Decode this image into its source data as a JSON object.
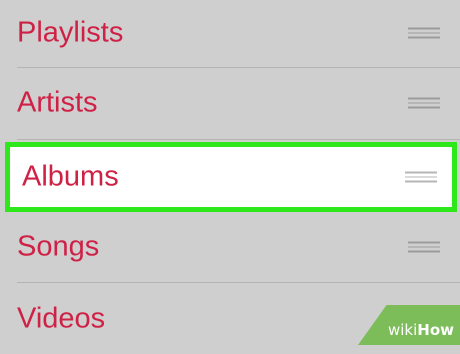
{
  "menu": {
    "items": [
      {
        "label": "Playlists"
      },
      {
        "label": "Artists"
      },
      {
        "label": "Albums",
        "selected": true
      },
      {
        "label": "Songs"
      },
      {
        "label": "Videos"
      }
    ]
  },
  "colors": {
    "label": "#cf2146",
    "highlight_border": "#2ee81b",
    "background": "#cfcfcf",
    "selected_background": "#ffffff"
  },
  "watermark": {
    "prefix": "wiki",
    "suffix": "How"
  }
}
